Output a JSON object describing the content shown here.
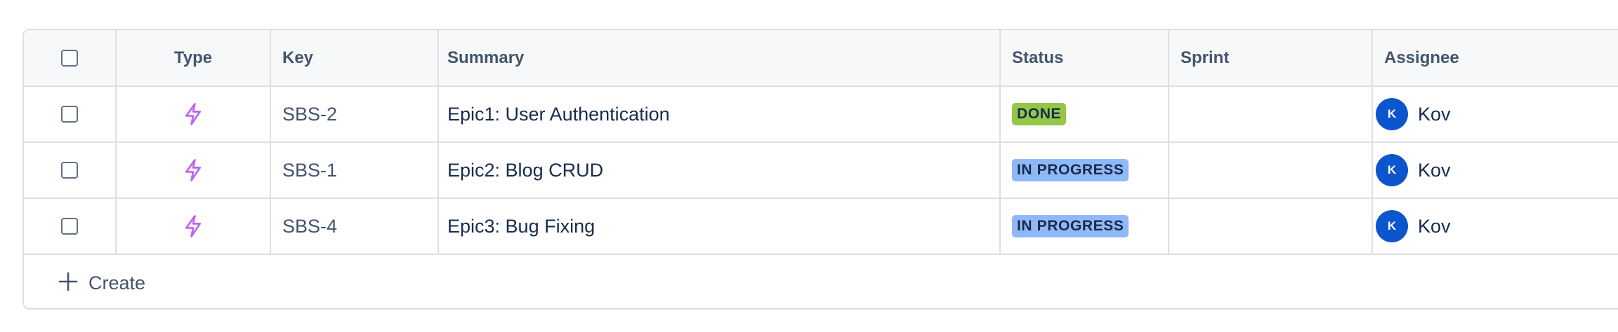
{
  "table": {
    "columns": {
      "type": "Type",
      "key": "Key",
      "summary": "Summary",
      "status": "Status",
      "sprint": "Sprint",
      "assignee": "Assignee"
    },
    "rows": [
      {
        "type_icon": "epic-lightning-icon",
        "key": "SBS-2",
        "summary": "Epic1: User Authentication",
        "status": "DONE",
        "status_color": "#94c748",
        "sprint": "",
        "assignee_initial": "K",
        "assignee_name": "Kov"
      },
      {
        "type_icon": "epic-lightning-icon",
        "key": "SBS-1",
        "summary": "Epic2: Blog CRUD",
        "status": "IN PROGRESS",
        "status_color": "#8fb8f6",
        "sprint": "",
        "assignee_initial": "K",
        "assignee_name": "Kov"
      },
      {
        "type_icon": "epic-lightning-icon",
        "key": "SBS-4",
        "summary": "Epic3: Bug Fixing",
        "status": "IN PROGRESS",
        "status_color": "#8fb8f6",
        "sprint": "",
        "assignee_initial": "K",
        "assignee_name": "Kov"
      }
    ],
    "create_label": "Create"
  },
  "colors": {
    "epic_icon": "#bf63f3",
    "avatar_bg": "#0c55cf",
    "border": "#dcdfe4",
    "header_bg": "#f7f8f9"
  }
}
